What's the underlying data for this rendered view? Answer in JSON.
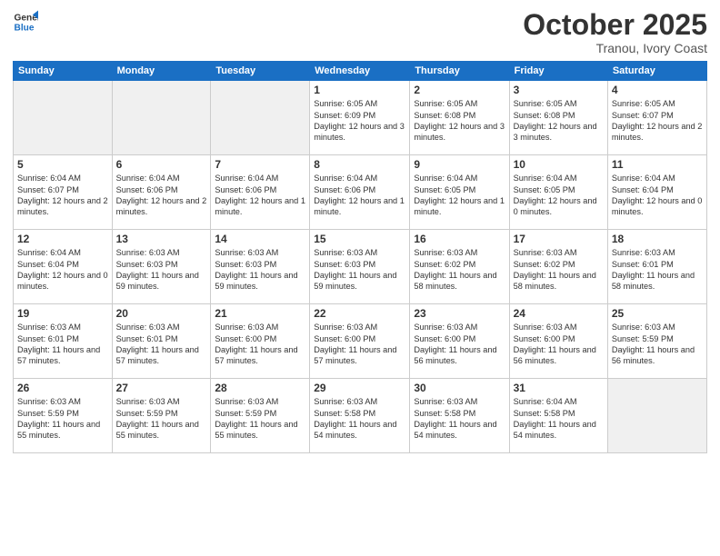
{
  "logo": {
    "line1": "General",
    "line2": "Blue"
  },
  "title": "October 2025",
  "subtitle": "Tranou, Ivory Coast",
  "weekdays": [
    "Sunday",
    "Monday",
    "Tuesday",
    "Wednesday",
    "Thursday",
    "Friday",
    "Saturday"
  ],
  "weeks": [
    [
      {
        "day": "",
        "info": ""
      },
      {
        "day": "",
        "info": ""
      },
      {
        "day": "",
        "info": ""
      },
      {
        "day": "1",
        "info": "Sunrise: 6:05 AM\nSunset: 6:09 PM\nDaylight: 12 hours and 3 minutes."
      },
      {
        "day": "2",
        "info": "Sunrise: 6:05 AM\nSunset: 6:08 PM\nDaylight: 12 hours and 3 minutes."
      },
      {
        "day": "3",
        "info": "Sunrise: 6:05 AM\nSunset: 6:08 PM\nDaylight: 12 hours and 3 minutes."
      },
      {
        "day": "4",
        "info": "Sunrise: 6:05 AM\nSunset: 6:07 PM\nDaylight: 12 hours and 2 minutes."
      }
    ],
    [
      {
        "day": "5",
        "info": "Sunrise: 6:04 AM\nSunset: 6:07 PM\nDaylight: 12 hours and 2 minutes."
      },
      {
        "day": "6",
        "info": "Sunrise: 6:04 AM\nSunset: 6:06 PM\nDaylight: 12 hours and 2 minutes."
      },
      {
        "day": "7",
        "info": "Sunrise: 6:04 AM\nSunset: 6:06 PM\nDaylight: 12 hours and 1 minute."
      },
      {
        "day": "8",
        "info": "Sunrise: 6:04 AM\nSunset: 6:06 PM\nDaylight: 12 hours and 1 minute."
      },
      {
        "day": "9",
        "info": "Sunrise: 6:04 AM\nSunset: 6:05 PM\nDaylight: 12 hours and 1 minute."
      },
      {
        "day": "10",
        "info": "Sunrise: 6:04 AM\nSunset: 6:05 PM\nDaylight: 12 hours and 0 minutes."
      },
      {
        "day": "11",
        "info": "Sunrise: 6:04 AM\nSunset: 6:04 PM\nDaylight: 12 hours and 0 minutes."
      }
    ],
    [
      {
        "day": "12",
        "info": "Sunrise: 6:04 AM\nSunset: 6:04 PM\nDaylight: 12 hours and 0 minutes."
      },
      {
        "day": "13",
        "info": "Sunrise: 6:03 AM\nSunset: 6:03 PM\nDaylight: 11 hours and 59 minutes."
      },
      {
        "day": "14",
        "info": "Sunrise: 6:03 AM\nSunset: 6:03 PM\nDaylight: 11 hours and 59 minutes."
      },
      {
        "day": "15",
        "info": "Sunrise: 6:03 AM\nSunset: 6:03 PM\nDaylight: 11 hours and 59 minutes."
      },
      {
        "day": "16",
        "info": "Sunrise: 6:03 AM\nSunset: 6:02 PM\nDaylight: 11 hours and 58 minutes."
      },
      {
        "day": "17",
        "info": "Sunrise: 6:03 AM\nSunset: 6:02 PM\nDaylight: 11 hours and 58 minutes."
      },
      {
        "day": "18",
        "info": "Sunrise: 6:03 AM\nSunset: 6:01 PM\nDaylight: 11 hours and 58 minutes."
      }
    ],
    [
      {
        "day": "19",
        "info": "Sunrise: 6:03 AM\nSunset: 6:01 PM\nDaylight: 11 hours and 57 minutes."
      },
      {
        "day": "20",
        "info": "Sunrise: 6:03 AM\nSunset: 6:01 PM\nDaylight: 11 hours and 57 minutes."
      },
      {
        "day": "21",
        "info": "Sunrise: 6:03 AM\nSunset: 6:00 PM\nDaylight: 11 hours and 57 minutes."
      },
      {
        "day": "22",
        "info": "Sunrise: 6:03 AM\nSunset: 6:00 PM\nDaylight: 11 hours and 57 minutes."
      },
      {
        "day": "23",
        "info": "Sunrise: 6:03 AM\nSunset: 6:00 PM\nDaylight: 11 hours and 56 minutes."
      },
      {
        "day": "24",
        "info": "Sunrise: 6:03 AM\nSunset: 6:00 PM\nDaylight: 11 hours and 56 minutes."
      },
      {
        "day": "25",
        "info": "Sunrise: 6:03 AM\nSunset: 5:59 PM\nDaylight: 11 hours and 56 minutes."
      }
    ],
    [
      {
        "day": "26",
        "info": "Sunrise: 6:03 AM\nSunset: 5:59 PM\nDaylight: 11 hours and 55 minutes."
      },
      {
        "day": "27",
        "info": "Sunrise: 6:03 AM\nSunset: 5:59 PM\nDaylight: 11 hours and 55 minutes."
      },
      {
        "day": "28",
        "info": "Sunrise: 6:03 AM\nSunset: 5:59 PM\nDaylight: 11 hours and 55 minutes."
      },
      {
        "day": "29",
        "info": "Sunrise: 6:03 AM\nSunset: 5:58 PM\nDaylight: 11 hours and 54 minutes."
      },
      {
        "day": "30",
        "info": "Sunrise: 6:03 AM\nSunset: 5:58 PM\nDaylight: 11 hours and 54 minutes."
      },
      {
        "day": "31",
        "info": "Sunrise: 6:04 AM\nSunset: 5:58 PM\nDaylight: 11 hours and 54 minutes."
      },
      {
        "day": "",
        "info": ""
      }
    ]
  ]
}
